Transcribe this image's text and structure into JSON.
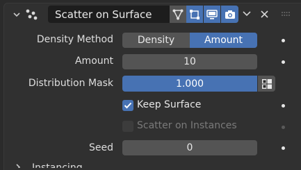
{
  "modifier": {
    "name": "Scatter on Surface",
    "icons": [
      "node-tree-icon",
      "edit-mode-icon",
      "viewport-display-icon",
      "render-icon"
    ]
  },
  "fields": {
    "density_method_label": "Density Method",
    "density_options": [
      "Density",
      "Amount"
    ],
    "density_selected": "Amount",
    "amount_label": "Amount",
    "amount_value": "10",
    "distribution_mask_label": "Distribution Mask",
    "distribution_mask_value": "1.000",
    "keep_surface_label": "Keep Surface",
    "keep_surface_checked": true,
    "scatter_instances_label": "Scatter on Instances",
    "scatter_instances_checked": false,
    "seed_label": "Seed",
    "seed_value": "0"
  },
  "section": {
    "instancing_label": "Instancing"
  },
  "colors": {
    "accent": "#4772b3",
    "field": "#545454",
    "panel": "#303030",
    "background": "#2b2b2b"
  }
}
